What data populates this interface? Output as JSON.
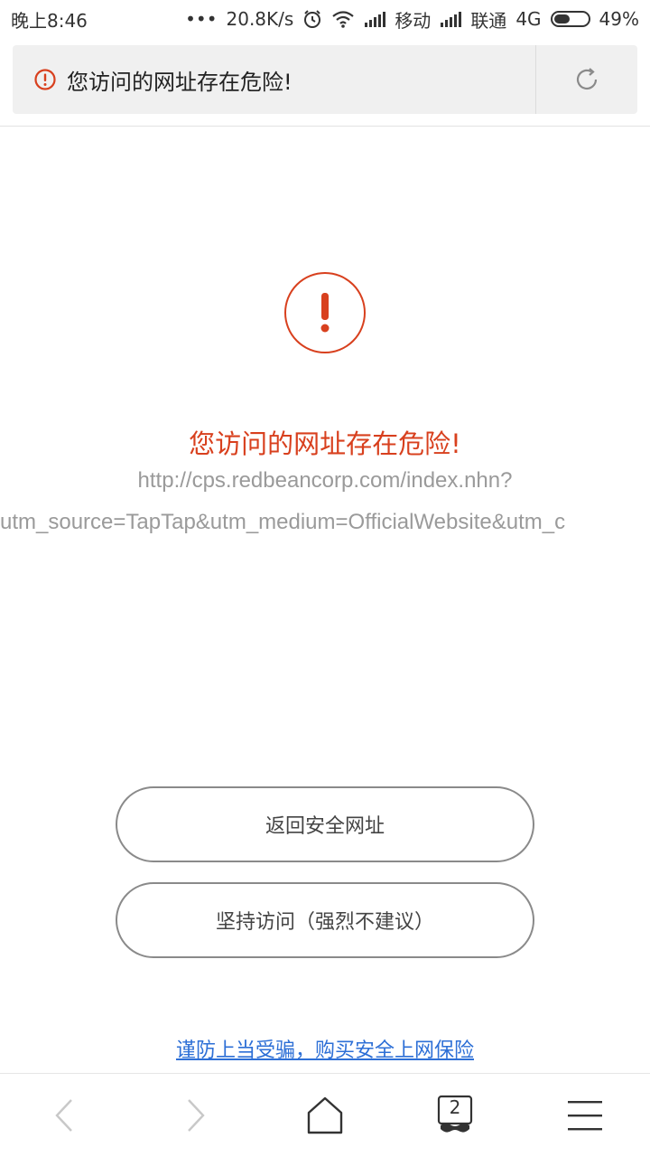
{
  "status_bar": {
    "time": "晚上8:46",
    "dots": "•••",
    "net_speed": "20.8K/s",
    "carrier1": "移动",
    "carrier2": "联通",
    "network_type": "4G",
    "battery": "49%",
    "battery_level": 0.49
  },
  "address_bar": {
    "title": "您访问的网址存在危险!",
    "icons": {
      "warning": "warning-icon",
      "refresh": "refresh-icon"
    }
  },
  "main": {
    "danger_title": "您访问的网址存在危险!",
    "url_line1": "http://cps.redbeancorp.com/index.nhn?",
    "url_line2": "utm_source=TapTap&utm_medium=OfficialWebsite&utm_c",
    "back_button": "返回安全网址",
    "continue_button": "坚持访问（强烈不建议）",
    "insurance_link": "谨防上当受骗，购买安全上网保险"
  },
  "bottom_nav": {
    "tab_count": "2",
    "icons": [
      "back-icon",
      "forward-icon",
      "home-icon",
      "tabs-icon",
      "menu-icon"
    ]
  },
  "colors": {
    "danger": "#d8401e",
    "link": "#2d6fd6",
    "url_gray": "#9a9a9a"
  }
}
